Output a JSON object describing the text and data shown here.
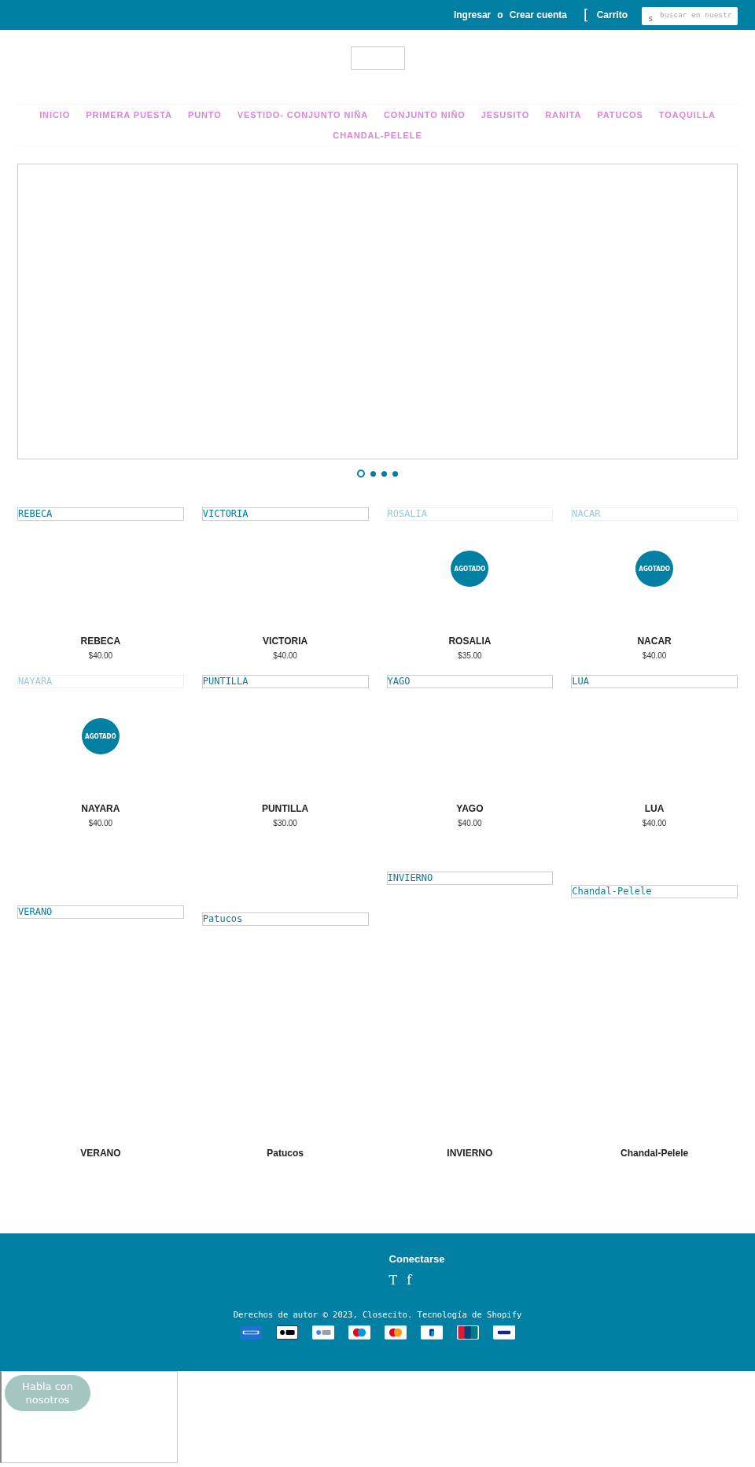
{
  "top_bar": {
    "login": "Ingresar",
    "separator": "o",
    "register": "Crear cuenta",
    "cart_glyph": "[",
    "cart": "Carrito",
    "search": {
      "icon_glyph": "s",
      "placeholder": "buscar en nuestr"
    }
  },
  "nav": {
    "items": [
      {
        "label": "INICIO"
      },
      {
        "label": "PRIMERA PUESTA"
      },
      {
        "label": "PUNTO"
      },
      {
        "label": "VESTIDO- CONJUNTO NIÑA"
      },
      {
        "label": "CONJUNTO NIÑO"
      },
      {
        "label": "JESUSITO"
      },
      {
        "label": "RANITA"
      },
      {
        "label": "PATUCOS"
      },
      {
        "label": "TOAQUILLA"
      },
      {
        "label": "CHANDAL-PELELE"
      }
    ]
  },
  "slideshow": {
    "dots": [
      {
        "selected": true
      },
      {
        "selected": false
      },
      {
        "selected": false
      },
      {
        "selected": false
      }
    ]
  },
  "products": [
    {
      "image_alt": "REBECA",
      "name": "REBECA",
      "price": "$40.00",
      "sold_out": false
    },
    {
      "image_alt": "VICTORIA",
      "name": "VICTORIA",
      "price": "$40.00",
      "sold_out": false
    },
    {
      "image_alt": "ROSALIA",
      "name": "ROSALIA",
      "price": "$35.00",
      "sold_out": true,
      "badge": "AGOTADO"
    },
    {
      "image_alt": "NACAR",
      "name": "NACAR",
      "price": "$40.00",
      "sold_out": true,
      "badge": "AGOTADO"
    },
    {
      "image_alt": "NAYARA",
      "name": "NAYARA",
      "price": "$40.00",
      "sold_out": true,
      "badge": "AGOTADO"
    },
    {
      "image_alt": "PUNTILLA",
      "name": "PUNTILLA",
      "price": "$30.00",
      "sold_out": false
    },
    {
      "image_alt": "YAGO",
      "name": "YAGO",
      "price": "$40.00",
      "sold_out": false
    },
    {
      "image_alt": "LUA",
      "name": "LUA",
      "price": "$40.00",
      "sold_out": false
    }
  ],
  "collections": [
    {
      "image_alt": "VERANO",
      "name": "VERANO"
    },
    {
      "image_alt": "Patucos",
      "name": "Patucos"
    },
    {
      "image_alt": "INVIERNO",
      "name": "INVIERNO"
    },
    {
      "image_alt": "Chandal-Pelele",
      "name": "Chandal-Pelele"
    }
  ],
  "footer": {
    "heading": "Conectarse",
    "social": [
      {
        "glyph": "T"
      },
      {
        "glyph": "f"
      }
    ],
    "copyright": "Derechos de autor © 2023, Closecito. Tecnología de Shopify",
    "payments": [
      {
        "kind": "amex"
      },
      {
        "kind": "apple_pay"
      },
      {
        "kind": "google_pay"
      },
      {
        "kind": "maestro"
      },
      {
        "kind": "mastercard"
      },
      {
        "kind": "paypal"
      },
      {
        "kind": "unionpay"
      },
      {
        "kind": "visa"
      }
    ]
  },
  "chat": {
    "button": "Habla con nosotros"
  }
}
